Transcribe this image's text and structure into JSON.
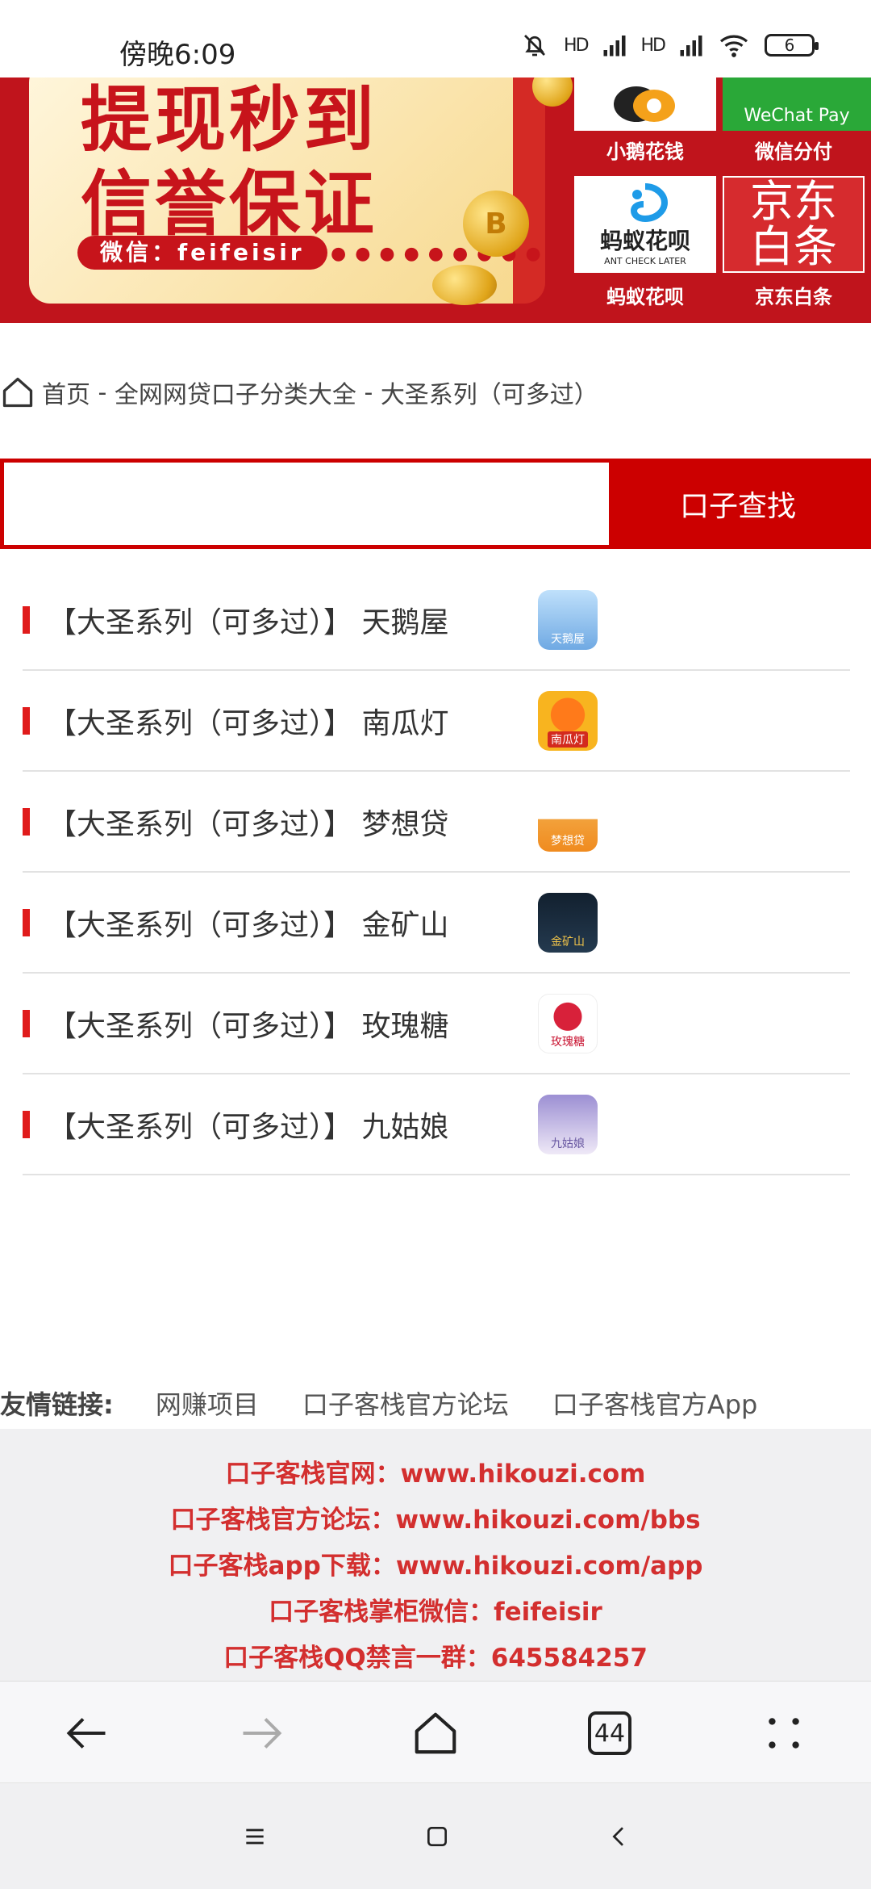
{
  "status_bar": {
    "time": "傍晚6:09",
    "network_label_1": "HD",
    "network_label_2": "HD",
    "battery": "6"
  },
  "banner": {
    "title_line1": "提现秒到",
    "title_line2": "信誉保证",
    "wechat": "微信：feifeisir",
    "coin_symbol": "B",
    "tiles": [
      {
        "label": "小鹅花钱",
        "icon": "xiaoe-logo"
      },
      {
        "label": "微信分付",
        "icon": "wechat-pay-logo",
        "logo_text": "WeChat Pay"
      },
      {
        "label": "蚂蚁花呗",
        "icon": "ant-huabei-logo",
        "logo_text": "蚂蚁花呗",
        "logo_sub": "ANT CHECK LATER"
      },
      {
        "label": "京东白条",
        "icon": "jd-baitiao-logo",
        "logo_text_1": "京东",
        "logo_text_2": "白条"
      }
    ]
  },
  "breadcrumb": {
    "home": "首页",
    "sep1": " - ",
    "category": "全网网贷口子分类大全",
    "sep2": " - ",
    "current": "大圣系列（可多过）"
  },
  "search": {
    "placeholder": "",
    "button_label": "口子查找"
  },
  "items": [
    {
      "label": "【大圣系列（可多过）】 天鹅屋",
      "icon": "swan-house-icon",
      "icon_text": "天鹅屋",
      "color": "#7fb6e8"
    },
    {
      "label": "【大圣系列（可多过）】 南瓜灯",
      "icon": "pumpkin-lamp-icon",
      "icon_text": "南瓜灯",
      "color": "#f5a21b"
    },
    {
      "label": "【大圣系列（可多过）】 梦想贷",
      "icon": "dream-loan-icon",
      "icon_text": "梦想贷",
      "color": "#f3b76a"
    },
    {
      "label": "【大圣系列（可多过）】 金矿山",
      "icon": "gold-mountain-icon",
      "icon_text": "金矿山",
      "color": "#1d2a3a"
    },
    {
      "label": "【大圣系列（可多过）】 玫瑰糖",
      "icon": "rose-candy-icon",
      "icon_text": "玫瑰糖",
      "color": "#ffffff"
    },
    {
      "label": "【大圣系列（可多过）】 九姑娘",
      "icon": "nine-girl-icon",
      "icon_text": "九姑娘",
      "color": "#b9a7d9"
    }
  ],
  "friend_links": {
    "title": "友情链接:",
    "links": [
      "网赚项目",
      "口子客栈官方论坛",
      "口子客栈官方App"
    ]
  },
  "footer": {
    "lines": [
      "口子客栈官网：www.hikouzi.com",
      "口子客栈官方论坛：www.hikouzi.com/bbs",
      "口子客栈app下载：www.hikouzi.com/app",
      "口子客栈掌柜微信：feifeisir",
      "口子客栈QQ禁言一群：645584257"
    ]
  },
  "browser_bar": {
    "tab_count": "44"
  },
  "colors": {
    "brand_red": "#cc0000",
    "footer_red": "#d32f2f"
  }
}
